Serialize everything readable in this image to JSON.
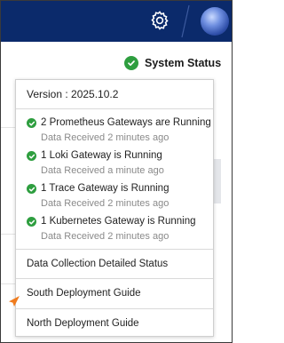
{
  "header": {
    "settings_icon": "gear-icon",
    "avatar_icon": "user-avatar"
  },
  "status": {
    "label": "System Status",
    "icon": "check-circle-icon",
    "color": "#2e9e3f"
  },
  "dropdown": {
    "version": "Version : 2025.10.2",
    "gateways": [
      {
        "title": "2 Prometheus Gateways are Running",
        "subtitle": "Data Received 2 minutes ago"
      },
      {
        "title": "1 Loki Gateway is Running",
        "subtitle": "Data Received a minute ago"
      },
      {
        "title": "1 Trace Gateway is Running",
        "subtitle": "Data Received 2 minutes ago"
      },
      {
        "title": "1 Kubernetes Gateway is Running",
        "subtitle": "Data Received 2 minutes ago"
      }
    ],
    "links": {
      "data_collection": "Data Collection Detailed Status",
      "south_guide": "South Deployment Guide",
      "north_guide": "North Deployment Guide"
    }
  },
  "colors": {
    "header_bg": "#0b2a6b",
    "accent_orange": "#f07c1e"
  }
}
